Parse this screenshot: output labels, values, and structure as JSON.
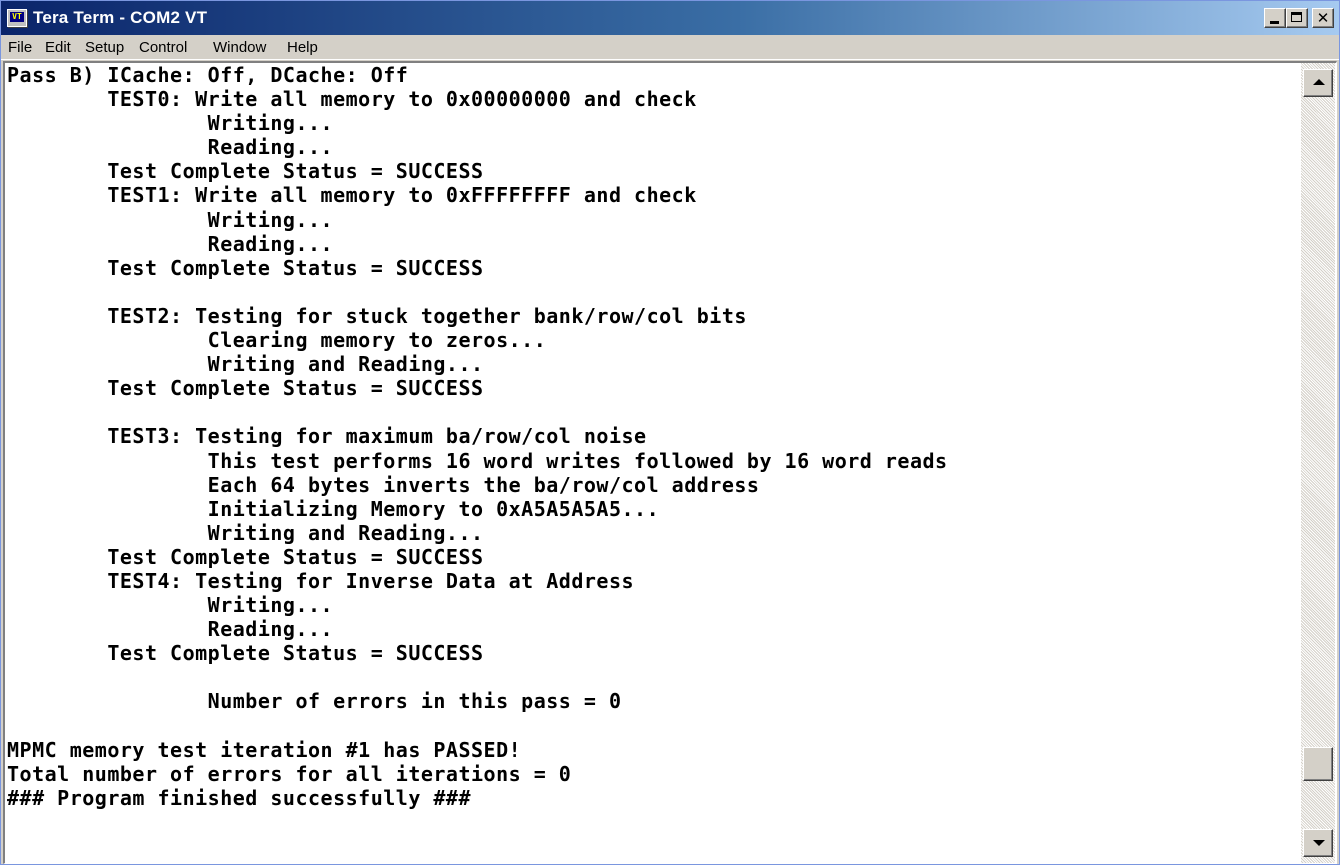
{
  "window": {
    "title": "Tera Term - COM2 VT",
    "app_icon_text": "VT"
  },
  "menu": {
    "items": [
      "File",
      "Edit",
      "Setup",
      "Control",
      "Window",
      "Help"
    ]
  },
  "terminal": {
    "lines": [
      "Pass B) ICache: Off, DCache: Off",
      "        TEST0: Write all memory to 0x00000000 and check",
      "                Writing...",
      "                Reading...",
      "        Test Complete Status = SUCCESS",
      "        TEST1: Write all memory to 0xFFFFFFFF and check",
      "                Writing...",
      "                Reading...",
      "        Test Complete Status = SUCCESS",
      "",
      "        TEST2: Testing for stuck together bank/row/col bits",
      "                Clearing memory to zeros...",
      "                Writing and Reading...",
      "        Test Complete Status = SUCCESS",
      "",
      "        TEST3: Testing for maximum ba/row/col noise",
      "                This test performs 16 word writes followed by 16 word reads",
      "                Each 64 bytes inverts the ba/row/col address",
      "                Initializing Memory to 0xA5A5A5A5...",
      "                Writing and Reading...",
      "        Test Complete Status = SUCCESS",
      "        TEST4: Testing for Inverse Data at Address",
      "                Writing...",
      "                Reading...",
      "        Test Complete Status = SUCCESS",
      "",
      "                Number of errors in this pass = 0",
      "",
      "MPMC memory test iteration #1 has PASSED!",
      "Total number of errors for all iterations = 0",
      "### Program finished successfully ###"
    ]
  },
  "colors": {
    "title_gradient_start": "#0a246a",
    "title_gradient_end": "#a6caf0",
    "terminal_bg": "#ffffff",
    "terminal_fg": "#000000"
  },
  "icons": {
    "minimize": "minimize-icon",
    "maximize": "maximize-icon",
    "close": "close-icon",
    "scroll_up": "arrow-up-icon",
    "scroll_down": "arrow-down-icon"
  }
}
